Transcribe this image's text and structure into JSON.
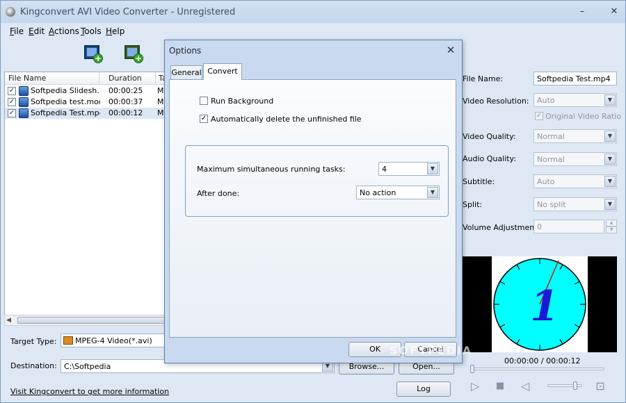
{
  "window": {
    "title": "Kingconvert AVI Video Converter - Unregistered",
    "minimize": "–",
    "close": "✕"
  },
  "menu": [
    {
      "first": "F",
      "rest": "ile"
    },
    {
      "first": "E",
      "rest": "dit"
    },
    {
      "first": "A",
      "rest": "ctions"
    },
    {
      "first": "T",
      "rest": "ools"
    },
    {
      "first": "H",
      "rest": "elp"
    }
  ],
  "toolbar": {
    "add_video_icon": "add-video-icon",
    "add_folder_icon": "add-folder-icon",
    "plus": "+"
  },
  "file_list": {
    "columns": [
      "File Name",
      "Duration",
      "Ta"
    ],
    "rows": [
      {
        "checked": "✓",
        "name": "Softpedia Slidesh...",
        "duration": "00:00:25",
        "target": "MP"
      },
      {
        "checked": "✓",
        "name": "Softpedia test.mod",
        "duration": "00:00:37",
        "target": "MP"
      },
      {
        "checked": "✓",
        "name": "Softpedia Test.mp4",
        "duration": "00:00:12",
        "target": "MP"
      }
    ],
    "scroll_left": "◀"
  },
  "bottom": {
    "target_type_label": "Target Type:",
    "target_type_value": "MPEG-4 Video(*.avi)",
    "destination_label": "Destination:",
    "destination_value": "C:\\Softpedia",
    "browse": "Browse...",
    "open": "Open...",
    "log": "Log",
    "link": "Visit Kingconvert to get more information",
    "drop_arrow": "▼"
  },
  "properties": {
    "file_name_label": "File Name:",
    "file_name_value": "Softpedia Test.mp4",
    "video_resolution_label": "Video Resolution:",
    "video_resolution_value": "Auto",
    "original_ratio_label": "Original Video Ratio",
    "original_ratio_check": "✓",
    "video_quality_label": "Video Quality:",
    "video_quality_value": "Normal",
    "audio_quality_label": "Audio Quality:",
    "audio_quality_value": "Normal",
    "subtitle_label": "Subtitle:",
    "subtitle_value": "Auto",
    "split_label": "Split:",
    "split_value": "No split",
    "volume_label": "Volume Adjustment:",
    "volume_value": "0",
    "spin_up": "▲",
    "spin_down": "▼"
  },
  "player": {
    "timecode": "00:00:00 / 00:00:12",
    "seek_fraction": 0.0,
    "volume_fraction": 0.85,
    "play": "▷",
    "stop": "■",
    "mute": "◁",
    "snapshot": "⊡",
    "preview_digit": "1",
    "clock_face_color": "#00ffff",
    "digit_color": "#1a1ad6"
  },
  "watermark": "SOFTPEDIA",
  "options_dialog": {
    "title": "Options",
    "close": "✕",
    "tabs": [
      "General",
      "Convert"
    ],
    "active_tab": "Convert",
    "run_background_label": "Run Background",
    "run_background_check": "",
    "auto_delete_label": "Automatically delete the unfinished file",
    "auto_delete_check": "✓",
    "max_tasks_label": "Maximum simultaneous running tasks:",
    "max_tasks_value": "4",
    "after_done_label": "After done:",
    "after_done_value": "No action",
    "ok": "OK",
    "cancel": "Cancel"
  }
}
